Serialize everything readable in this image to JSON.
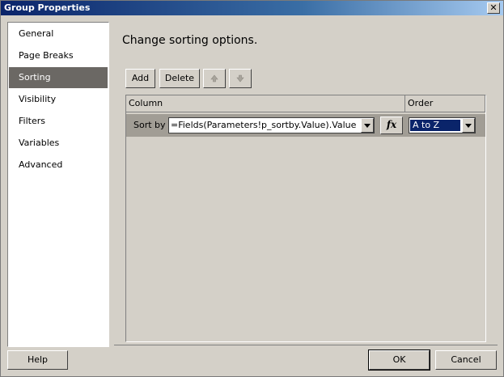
{
  "window": {
    "title": "Group Properties",
    "close_label": "✕"
  },
  "sidebar": {
    "items": [
      {
        "label": "General"
      },
      {
        "label": "Page Breaks"
      },
      {
        "label": "Sorting"
      },
      {
        "label": "Visibility"
      },
      {
        "label": "Filters"
      },
      {
        "label": "Variables"
      },
      {
        "label": "Advanced"
      }
    ],
    "selected": "Sorting"
  },
  "main": {
    "heading": "Change sorting options.",
    "toolbar": {
      "add_label": "Add",
      "delete_label": "Delete",
      "move_up_icon": "arrow-up-icon",
      "move_down_icon": "arrow-down-icon"
    },
    "grid": {
      "columns": [
        "Column",
        "Order"
      ],
      "rows": [
        {
          "label": "Sort by",
          "expression": "=Fields(Parameters!p_sortby.Value).Value",
          "fx_label": "fx",
          "order": "A to Z"
        }
      ]
    }
  },
  "footer": {
    "help_label": "Help",
    "ok_label": "OK",
    "cancel_label": "Cancel"
  },
  "colors": {
    "dialog_bg": "#d4d0c8",
    "selected_item_bg": "#6b6864",
    "row_bg": "#a19d95",
    "selection_bg": "#0a246a",
    "titlebar": "#0a246a"
  }
}
